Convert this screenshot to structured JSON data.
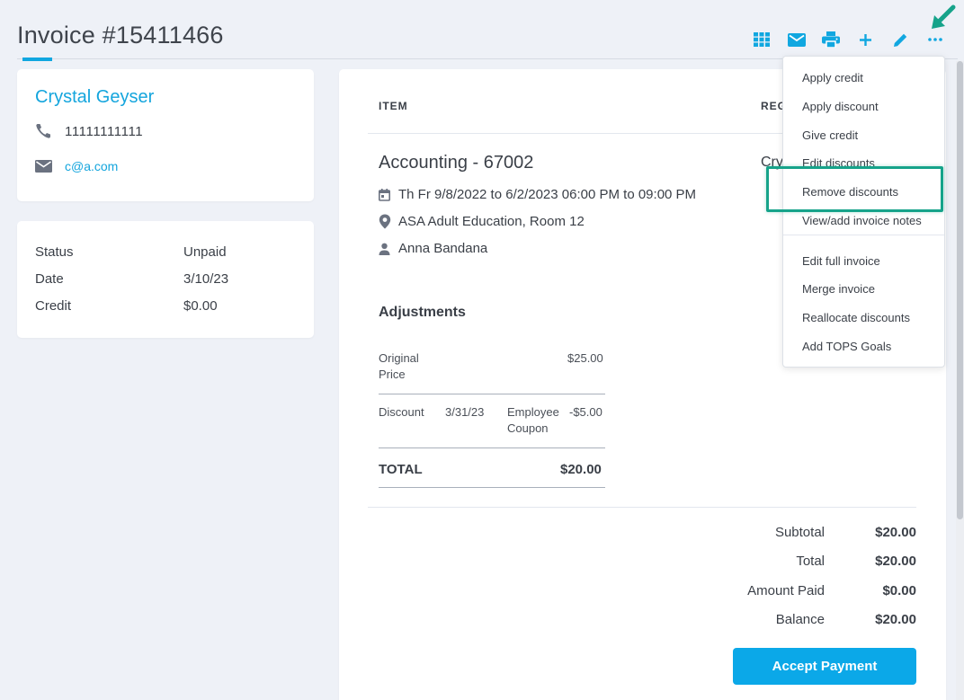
{
  "page": {
    "title": "Invoice #15411466"
  },
  "toolbar": {
    "icons": [
      "grid-icon",
      "mail-icon",
      "print-icon",
      "plus-icon",
      "pencil-icon",
      "more-icon"
    ]
  },
  "contact": {
    "name": "Crystal Geyser",
    "phone": "11111111111",
    "email": "c@a.com"
  },
  "status": {
    "rows": [
      {
        "label": "Status",
        "value": "Unpaid"
      },
      {
        "label": "Date",
        "value": "3/10/23"
      },
      {
        "label": "Credit",
        "value": "$0.00"
      }
    ]
  },
  "items": {
    "col_item": "ITEM",
    "col_reg": "REG",
    "title": "Accounting - 67002",
    "registrant_partial": "Cry",
    "schedule": "Th Fr 9/8/2022 to 6/2/2023 06:00 PM to 09:00 PM",
    "location": "ASA Adult Education, Room 12",
    "instructor": "Anna Bandana"
  },
  "adjustments": {
    "title": "Adjustments",
    "original_label_1": "Original",
    "original_label_2": "Price",
    "original_value": "$25.00",
    "discount_label": "Discount",
    "discount_date": "3/31/23",
    "discount_name_1": "Employee",
    "discount_name_2": "Coupon",
    "discount_value": "-$5.00",
    "total_label": "TOTAL",
    "total_value": "$20.00"
  },
  "summary": {
    "subtotal_label": "Subtotal",
    "subtotal_value": "$20.00",
    "total_label": "Total",
    "total_value": "$20.00",
    "paid_label": "Amount Paid",
    "paid_value": "$0.00",
    "balance_label": "Balance",
    "balance_value": "$20.00"
  },
  "accept_button": "Accept Payment",
  "menu": {
    "items": [
      "Apply credit",
      "Apply discount",
      "Give credit",
      "Edit discounts",
      "Remove discounts",
      "View/add invoice notes",
      "Edit full invoice",
      "Merge invoice",
      "Reallocate discounts",
      "Add TOPS Goals"
    ]
  },
  "colors": {
    "accent": "#11a7e0",
    "highlight": "#16a38a",
    "button": "#0ba8e8"
  }
}
